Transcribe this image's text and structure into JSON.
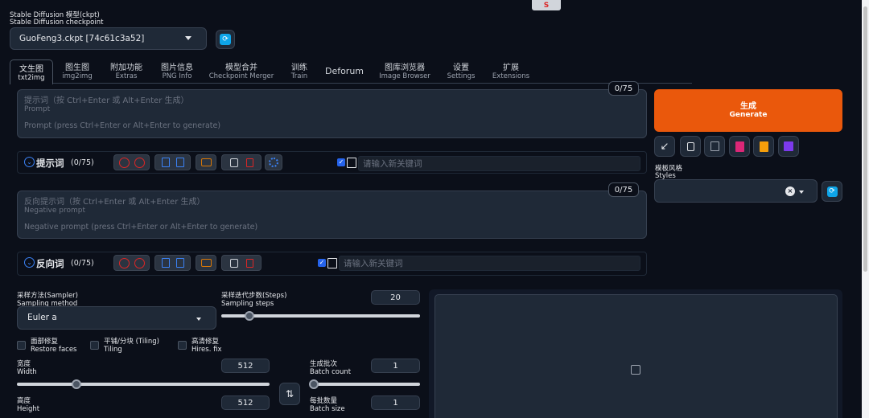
{
  "top_badge": "S",
  "model": {
    "label_cn": "Stable Diffusion 模型(ckpt)",
    "label_en": "Stable Diffusion checkpoint",
    "selected": "GuoFeng3.ckpt [74c61c3a52]"
  },
  "tabs": [
    {
      "cn": "文生图",
      "en": "txt2img"
    },
    {
      "cn": "图生图",
      "en": "img2img"
    },
    {
      "cn": "附加功能",
      "en": "Extras"
    },
    {
      "cn": "图片信息",
      "en": "PNG Info"
    },
    {
      "cn": "模型合并",
      "en": "Checkpoint Merger"
    },
    {
      "cn": "训练",
      "en": "Train"
    },
    {
      "cn": "Deforum",
      "en": ""
    },
    {
      "cn": "图库浏览器",
      "en": "Image Browser"
    },
    {
      "cn": "设置",
      "en": "Settings"
    },
    {
      "cn": "扩展",
      "en": "Extensions"
    }
  ],
  "prompt": {
    "counter": "0/75",
    "label_cn": "提示词（按 Ctrl+Enter 或 Alt+Enter 生成）",
    "label_en": "Prompt",
    "placeholder": "Prompt (press Ctrl+Enter or Alt+Enter to generate)",
    "toolbar_title": "提示词",
    "toolbar_count": "(0/75)",
    "keyword_placeholder": "请输入新关键词"
  },
  "negative": {
    "counter": "0/75",
    "label_cn": "反向提示词（按 Ctrl+Enter 或 Alt+Enter 生成）",
    "label_en": "Negative prompt",
    "placeholder": "Negative prompt (press Ctrl+Enter or Alt+Enter to generate)",
    "toolbar_title": "反向词",
    "toolbar_count": "(0/75)",
    "keyword_placeholder": "请输入新关键词"
  },
  "generate": {
    "cn": "生成",
    "en": "Generate"
  },
  "styles": {
    "label_cn": "模板风格",
    "label_en": "Styles"
  },
  "sampler": {
    "label_cn": "采样方法(Sampler)",
    "label_en": "Sampling method",
    "value": "Euler a"
  },
  "steps": {
    "label_cn": "采样迭代步数(Steps)",
    "label_en": "Sampling steps",
    "value": "20"
  },
  "checks": [
    {
      "cn": "面部修复",
      "en": "Restore faces"
    },
    {
      "cn": "平铺/分块 (Tiling)",
      "en": "Tiling"
    },
    {
      "cn": "高清修复",
      "en": "Hires. fix"
    }
  ],
  "width": {
    "label_cn": "宽度",
    "label_en": "Width",
    "value": "512"
  },
  "height": {
    "label_cn": "高度",
    "label_en": "Height",
    "value": "512"
  },
  "batch_count": {
    "label_cn": "生成批次",
    "label_en": "Batch count",
    "value": "1"
  },
  "batch_size": {
    "label_cn": "每批数量",
    "label_en": "Batch size",
    "value": "1"
  },
  "colors": {
    "accent": "#ea580c",
    "bg": "#0b0f19",
    "panel": "#1f2937",
    "check": "#2563eb"
  }
}
